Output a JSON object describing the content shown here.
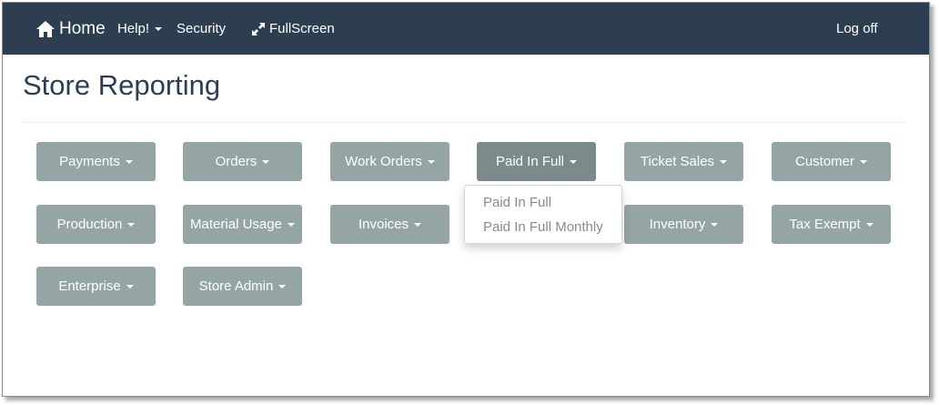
{
  "navbar": {
    "home_label": "Home",
    "help_label": "Help!",
    "security_label": "Security",
    "fullscreen_label": "FullScreen",
    "logoff_label": "Log off"
  },
  "page": {
    "title": "Store Reporting"
  },
  "buttons": [
    {
      "label": "Payments"
    },
    {
      "label": "Orders"
    },
    {
      "label": "Work Orders"
    },
    {
      "label": "Paid In Full"
    },
    {
      "label": "Ticket Sales"
    },
    {
      "label": "Customer"
    },
    {
      "label": "Production"
    },
    {
      "label": "Material Usage"
    },
    {
      "label": "Invoices"
    },
    {
      "label": "Inventory"
    },
    {
      "label": "Tax Exempt"
    },
    {
      "label": "Enterprise"
    },
    {
      "label": "Store Admin"
    }
  ],
  "dropdown": {
    "open_for": "Paid In Full",
    "items": [
      {
        "label": "Paid In Full"
      },
      {
        "label": "Paid In Full Monthly"
      }
    ]
  },
  "colors": {
    "navbar": "#2c3e50",
    "button": "#95a5a6",
    "button_active": "#7b8a8b",
    "title": "#2c3e50"
  },
  "icons": {
    "home": "home-icon",
    "fullscreen": "expand-arrows-icon",
    "caret": "caret-down-icon"
  }
}
